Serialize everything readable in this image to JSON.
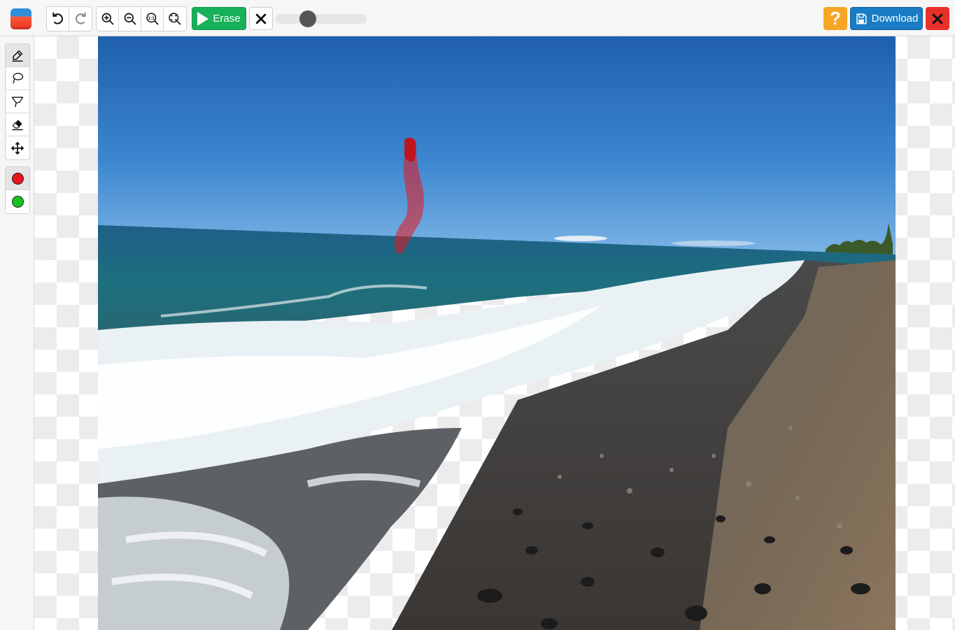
{
  "toolbar": {
    "logo": "app-logo",
    "undo_icon": "undo-icon",
    "redo_icon": "redo-icon",
    "zoom_in_icon": "zoom-in-icon",
    "zoom_out_icon": "zoom-out-icon",
    "zoom_actual_label": "1:1",
    "zoom_fit_icon": "zoom-fit-icon",
    "erase_label": "Erase",
    "clear_icon": "close-icon",
    "brush_size_fraction": 0.32,
    "help_label": "?",
    "download_label": "Download",
    "close_icon": "close-icon"
  },
  "tools": {
    "active": "brush",
    "items": [
      "brush-icon",
      "lasso-icon",
      "polygon-lasso-icon",
      "eraser-icon",
      "move-icon"
    ],
    "colors": {
      "remove": "#e8141b",
      "keep": "#17c41f"
    }
  },
  "colors": {
    "erase_green": "#16b15a",
    "download_blue": "#1a7cc4",
    "help_orange": "#f6a623",
    "close_red": "#e8312a",
    "mask_red": "#e8141b"
  }
}
